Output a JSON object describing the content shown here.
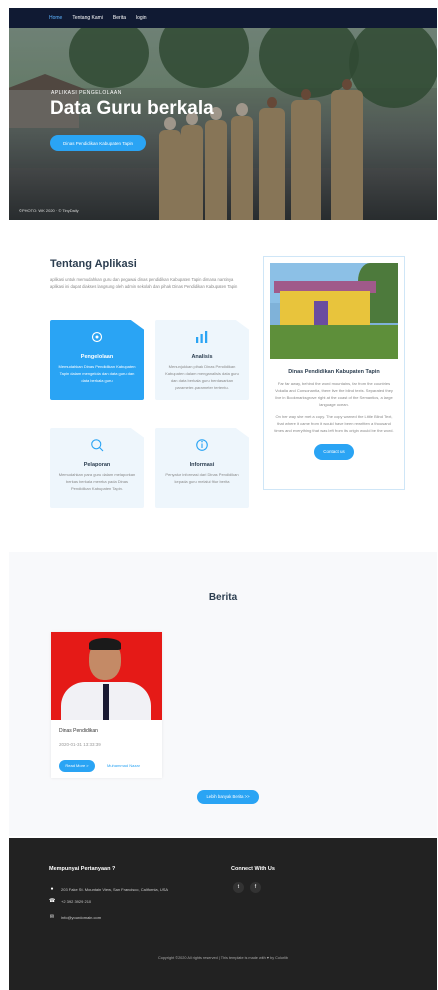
{
  "nav": {
    "items": [
      "Home",
      "Tentang Kami",
      "Berita",
      "login"
    ]
  },
  "hero": {
    "eyebrow": "APLIKASI PENGELOLAAN",
    "title": "Data Guru berkala",
    "button": "Dinas Pendidikan Kabupaten Tapin",
    "credit": "©PHOTO: WK 2020 · © TinyDaily"
  },
  "about": {
    "title": "Tentang Aplikasi",
    "description": "aplikasi untuk memudahkan guru dan pegawai dinas pendidikan Kabupaten Tapin dimana nantinya aplikasi ini dapat diakses langsung oleh admin sekolah dan pihak Dinas Pendidikan Kabupaten Tapin",
    "features": [
      {
        "title": "Pengelolaan",
        "desc": "Memudahkan Dinas Pendidikan Kabupaten Tapin dalam mengelola dan data guru dan data berkala guru",
        "icon": "settings-icon"
      },
      {
        "title": "Analisis",
        "desc": "Menunjukkan pihak Dinas Pendidikan Kabupaten dalam menganalisis data guru dan data berkala guru berdasarkan parameter-parameter tertentu.",
        "icon": "analytics-icon"
      },
      {
        "title": "Pelaporan",
        "desc": "Memudahkan para guru dalam melaporkan berkas berkala mereka pada Dinas Pendidikan Kabupaten Tapin.",
        "icon": "report-icon"
      },
      {
        "title": "Informasi",
        "desc": "Penyalur informasi dari Dinas Pendidikan kepada guru melalui fitur berita",
        "icon": "info-icon"
      }
    ],
    "card": {
      "title": "Dinas Pendidikan Kabupaten Tapin",
      "p1": "Far far away, behind the word mountains, far from the countries Vokalia and Consonantia, there live the blind texts. Separated they live in Bookmarksgrove right at the coast of the Semantics, a large language ocean.",
      "p2": "On her way she met a copy. The copy warned the Little Blind Text, that where it came from it would have been rewritten a thousand times and everything that was left from its origin would be the word.",
      "button": "Contact us"
    }
  },
  "news": {
    "title": "Berita",
    "items": [
      {
        "title": "Dinas Pendidikan",
        "date": "2020-01-31 13:33:39",
        "button": "Read More >",
        "author": "Muhammad Nazar"
      }
    ],
    "more": "Lebih banyak Berita >>"
  },
  "footer": {
    "contact_title": "Mempunyai Pertanyaan ?",
    "address": "203 Fake St. Mountain View, San Francisco, California, USA",
    "phone": "+2 392 3929 210",
    "email": "info@yourdomain.com",
    "social_title": "Connect With Us",
    "social": [
      "twitter-icon",
      "facebook-icon"
    ],
    "copyright": "Copyright ©2020 All rights reserved | This template is made with ♥ by Colorlib"
  },
  "colors": {
    "accent": "#2aa4f4",
    "nav": "#101a33",
    "footer": "#222222"
  }
}
